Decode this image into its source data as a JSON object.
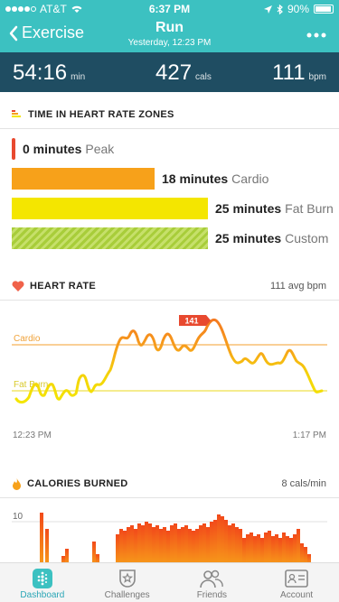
{
  "status_bar": {
    "carrier": "AT&T",
    "time": "6:37 PM",
    "battery": "90%"
  },
  "header": {
    "back_label": "Exercise",
    "title": "Run",
    "subtitle": "Yesterday, 12:23 PM"
  },
  "stats": {
    "duration_value": "54:16",
    "duration_unit": "min",
    "calories_value": "427",
    "calories_unit": "cals",
    "bpm_value": "111",
    "bpm_unit": "bpm"
  },
  "zones": {
    "title": "TIME IN HEART RATE ZONES",
    "items": [
      {
        "minutes": "0 minutes",
        "name": "Peak",
        "color": "#e8492f"
      },
      {
        "minutes": "18 minutes",
        "name": "Cardio",
        "color": "#f7a11a"
      },
      {
        "minutes": "25 minutes",
        "name": "Fat Burn",
        "color": "#f4e600"
      },
      {
        "minutes": "25 minutes",
        "name": "Custom",
        "color": "#a8cd3a"
      }
    ]
  },
  "heart_rate": {
    "title": "HEART RATE",
    "avg": "111 avg bpm",
    "peak_marker": "141",
    "cardio_line_label": "Cardio",
    "fatburn_line_label": "Fat Burn",
    "start_time": "12:23 PM",
    "end_time": "1:17 PM"
  },
  "calories": {
    "title": "CALORIES BURNED",
    "rate": "8 cals/min",
    "axis_top": "10"
  },
  "tabs": [
    {
      "label": "Dashboard",
      "active": true
    },
    {
      "label": "Challenges",
      "active": false
    },
    {
      "label": "Friends",
      "active": false
    },
    {
      "label": "Account",
      "active": false
    }
  ]
}
